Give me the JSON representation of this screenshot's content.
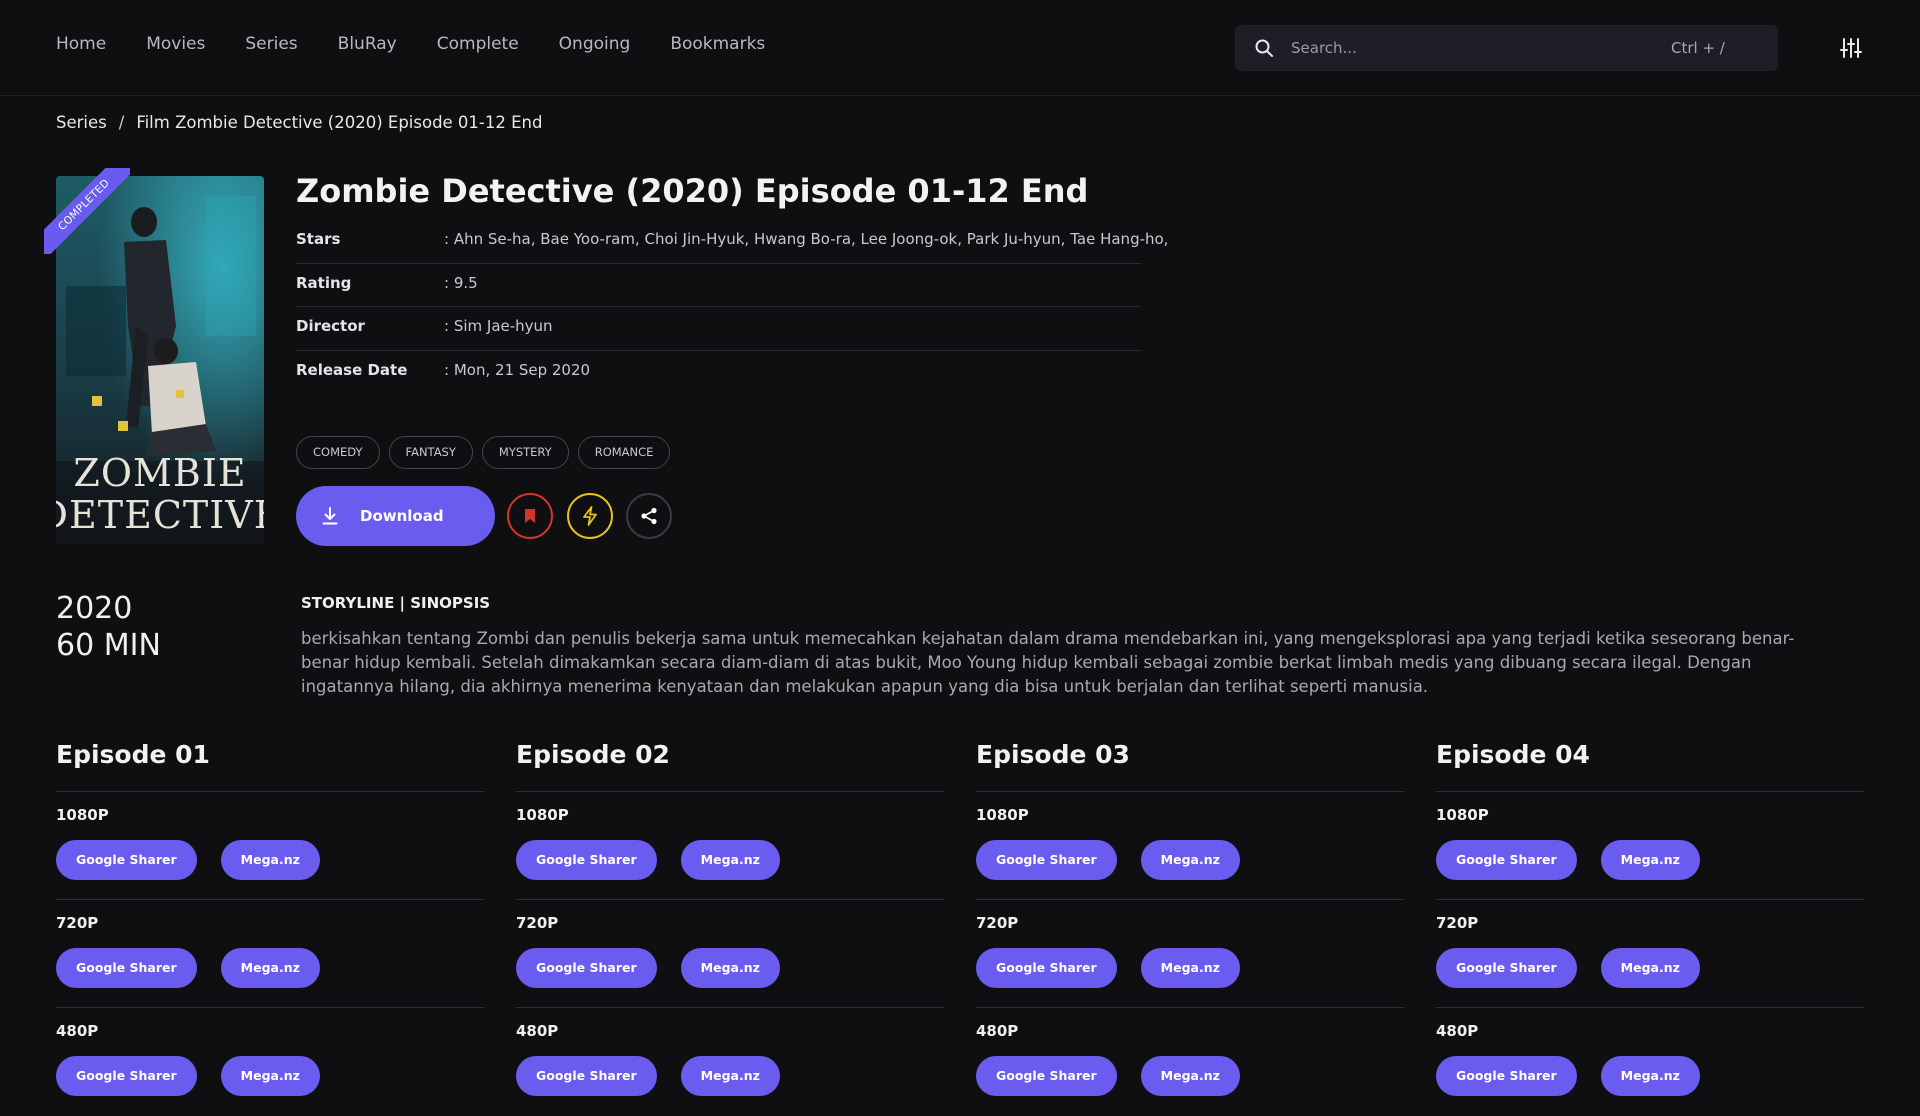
{
  "nav": {
    "items": [
      "Home",
      "Movies",
      "Series",
      "BluRay",
      "Complete",
      "Ongoing",
      "Bookmarks"
    ]
  },
  "search": {
    "placeholder": "Search...",
    "shortcut": "Ctrl + /"
  },
  "breadcrumb": {
    "items": [
      "Series",
      "Film Zombie Detective (2020) Episode 01-12 End"
    ],
    "separator": "/"
  },
  "poster": {
    "title_line1": "ZOMBIE",
    "title_line2": "DETECTIVE",
    "badge": "COMPLETED"
  },
  "detail": {
    "title": "Zombie Detective (2020) Episode 01-12 End",
    "info": [
      {
        "label": "Stars",
        "value": ": Ahn Se-ha, Bae Yoo-ram, Choi Jin-Hyuk, Hwang Bo-ra, Lee Joong-ok, Park Ju-hyun, Tae Hang-ho,"
      },
      {
        "label": "Rating",
        "value": ": 9.5"
      },
      {
        "label": "Director",
        "value": ": Sim Jae-hyun"
      },
      {
        "label": "Release Date",
        "value": ": Mon, 21 Sep 2020"
      }
    ],
    "tags": [
      "COMEDY",
      "FANTASY",
      "MYSTERY",
      "ROMANCE"
    ],
    "download_label": "Download",
    "colors": {
      "accent": "#6b5cf0",
      "bookmark": "#d3352b",
      "flash": "#e7c21b"
    }
  },
  "meta": {
    "year": "2020",
    "duration": "60 MIN"
  },
  "synopsis": {
    "title": "STORYLINE | SINOPSIS",
    "text": "berkisahkan tentang Zombi dan penulis bekerja sama untuk memecahkan kejahatan dalam drama mendebarkan ini, yang mengeksplorasi apa yang terjadi ketika seseorang benar-benar hidup kembali. Setelah dimakamkan secara diam-diam di atas bukit, Moo Young hidup kembali sebagai zombie berkat limbah medis yang dibuang secara ilegal. Dengan ingatannya hilang, dia akhirnya menerima kenyataan dan melakukan apapun yang dia bisa untuk berjalan dan terlihat seperti manusia."
  },
  "episodes": [
    {
      "title": "Episode 01",
      "qualities": [
        {
          "label": "1080P",
          "links": [
            "Google Sharer",
            "Mega.nz"
          ]
        },
        {
          "label": "720P",
          "links": [
            "Google Sharer",
            "Mega.nz"
          ]
        },
        {
          "label": "480P",
          "links": [
            "Google Sharer",
            "Mega.nz"
          ]
        }
      ]
    },
    {
      "title": "Episode 02",
      "qualities": [
        {
          "label": "1080P",
          "links": [
            "Google Sharer",
            "Mega.nz"
          ]
        },
        {
          "label": "720P",
          "links": [
            "Google Sharer",
            "Mega.nz"
          ]
        },
        {
          "label": "480P",
          "links": [
            "Google Sharer",
            "Mega.nz"
          ]
        }
      ]
    },
    {
      "title": "Episode 03",
      "qualities": [
        {
          "label": "1080P",
          "links": [
            "Google Sharer",
            "Mega.nz"
          ]
        },
        {
          "label": "720P",
          "links": [
            "Google Sharer",
            "Mega.nz"
          ]
        },
        {
          "label": "480P",
          "links": [
            "Google Sharer",
            "Mega.nz"
          ]
        }
      ]
    },
    {
      "title": "Episode 04",
      "qualities": [
        {
          "label": "1080P",
          "links": [
            "Google Sharer",
            "Mega.nz"
          ]
        },
        {
          "label": "720P",
          "links": [
            "Google Sharer",
            "Mega.nz"
          ]
        },
        {
          "label": "480P",
          "links": [
            "Google Sharer",
            "Mega.nz"
          ]
        }
      ]
    }
  ],
  "icons": {
    "search": "search-icon",
    "filter": "sliders-icon",
    "download": "download-icon",
    "bookmark": "bookmark-icon",
    "flash": "lightning-icon",
    "share": "share-icon"
  }
}
